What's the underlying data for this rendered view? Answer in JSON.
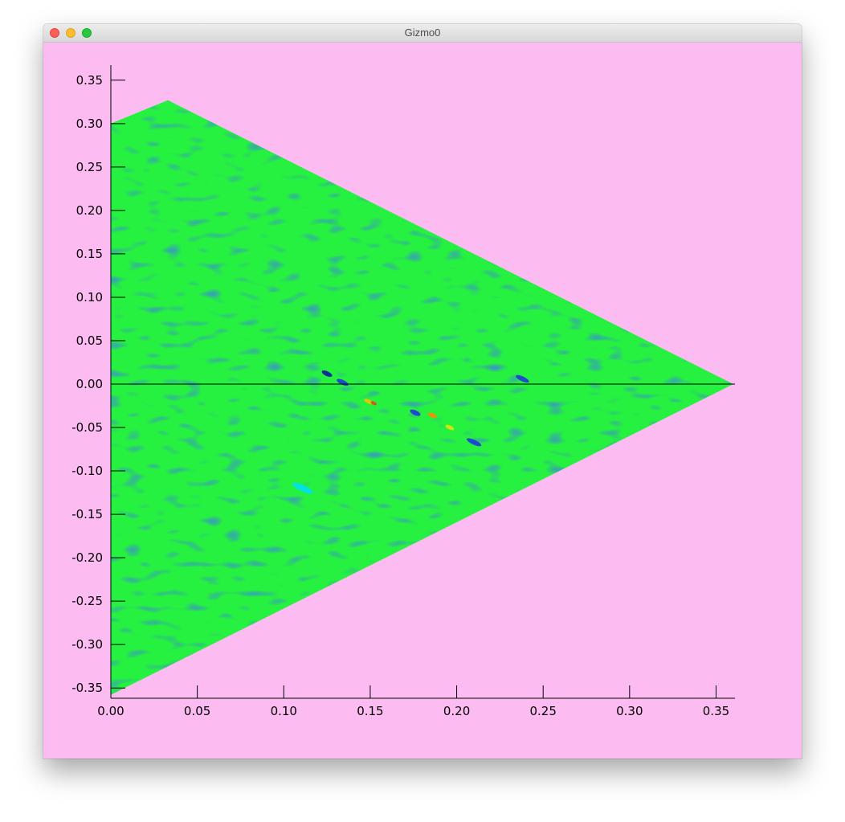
{
  "window": {
    "title": "Gizmo0"
  },
  "colors": {
    "background": "#fcbcf2",
    "axis": "#000000"
  },
  "chart_data": {
    "type": "heatmap",
    "title": "",
    "xlabel": "",
    "ylabel": "",
    "xlim": [
      0.0,
      0.36
    ],
    "ylim": [
      -0.36,
      0.36
    ],
    "x_ticks": [
      "0.00",
      "0.05",
      "0.10",
      "0.15",
      "0.20",
      "0.25",
      "0.30",
      "0.35"
    ],
    "y_ticks": [
      "0.35",
      "0.30",
      "0.25",
      "0.20",
      "0.15",
      "0.10",
      "0.05",
      "0.00",
      "-0.05",
      "-0.10",
      "-0.15",
      "-0.20",
      "-0.25",
      "-0.30",
      "-0.35"
    ],
    "region_polygon": [
      [
        0.0,
        0.3
      ],
      [
        0.033,
        0.327
      ],
      [
        0.36,
        0.0
      ],
      [
        0.0,
        -0.358
      ]
    ],
    "zero_line_y": 0.0,
    "colormap": "rainbow",
    "dominant_color": "green",
    "grid": false
  }
}
